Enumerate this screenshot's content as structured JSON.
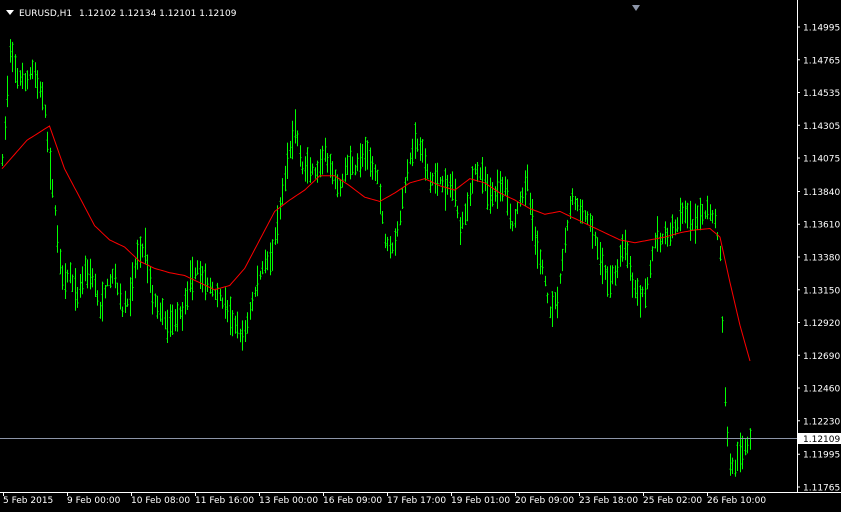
{
  "header": {
    "symbol": "EURUSD,H1",
    "ohlc": "1.12102 1.12134 1.12101 1.12109"
  },
  "colors": {
    "background": "#000000",
    "bars": "#00ff00",
    "moving_average": "#ff0000",
    "axis": "#ffffff",
    "price_line": "#8c95a8",
    "price_box": "#ffffff"
  },
  "icons": {
    "dropdown": "dropdown-triangle-icon",
    "shift_marker": "chart-shift-marker-icon"
  },
  "chart_data": {
    "type": "ohlc",
    "symbol": "EURUSD",
    "timeframe": "H1",
    "title": "EURUSD,H1",
    "current_price": 1.12109,
    "ylim": [
      1.1176,
      1.1507
    ],
    "y_ticks": [
      "1.14995",
      "1.14765",
      "1.14535",
      "1.14305",
      "1.14075",
      "1.13840",
      "1.13610",
      "1.13380",
      "1.13150",
      "1.12920",
      "1.12690",
      "1.12460",
      "1.12230",
      "1.11995",
      "1.11765"
    ],
    "x_ticks": [
      "5 Feb 2015",
      "9 Feb 00:00",
      "10 Feb 08:00",
      "11 Feb 16:00",
      "13 Feb 00:00",
      "16 Feb 09:00",
      "17 Feb 17:00",
      "19 Feb 01:00",
      "20 Feb 09:00",
      "23 Feb 18:00",
      "25 Feb 02:00",
      "26 Feb 10:00"
    ],
    "price_anchors": [
      [
        0,
        1.1405
      ],
      [
        3,
        1.148
      ],
      [
        6,
        1.1465
      ],
      [
        9,
        1.146
      ],
      [
        12,
        1.147
      ],
      [
        15,
        1.1455
      ],
      [
        17,
        1.144
      ],
      [
        19,
        1.14
      ],
      [
        21,
        1.137
      ],
      [
        24,
        1.132
      ],
      [
        27,
        1.1325
      ],
      [
        30,
        1.131
      ],
      [
        33,
        1.133
      ],
      [
        36,
        1.1325
      ],
      [
        39,
        1.13
      ],
      [
        42,
        1.132
      ],
      [
        45,
        1.1325
      ],
      [
        48,
        1.13
      ],
      [
        51,
        1.131
      ],
      [
        54,
        1.134
      ],
      [
        57,
        1.1345
      ],
      [
        60,
        1.131
      ],
      [
        63,
        1.13
      ],
      [
        66,
        1.129
      ],
      [
        69,
        1.1295
      ],
      [
        72,
        1.13
      ],
      [
        75,
        1.132
      ],
      [
        78,
        1.133
      ],
      [
        81,
        1.132
      ],
      [
        84,
        1.1315
      ],
      [
        87,
        1.131
      ],
      [
        90,
        1.13
      ],
      [
        93,
        1.129
      ],
      [
        96,
        1.128
      ],
      [
        99,
        1.13
      ],
      [
        102,
        1.132
      ],
      [
        105,
        1.1335
      ],
      [
        108,
        1.134
      ],
      [
        111,
        1.137
      ],
      [
        114,
        1.1405
      ],
      [
        117,
        1.143
      ],
      [
        120,
        1.14
      ],
      [
        123,
        1.14
      ],
      [
        126,
        1.1395
      ],
      [
        129,
        1.141
      ],
      [
        132,
        1.1395
      ],
      [
        135,
        1.1385
      ],
      [
        138,
        1.1405
      ],
      [
        141,
        1.14
      ],
      [
        144,
        1.141
      ],
      [
        147,
        1.1405
      ],
      [
        150,
        1.1395
      ],
      [
        153,
        1.135
      ],
      [
        156,
        1.1345
      ],
      [
        159,
        1.1365
      ],
      [
        162,
        1.14
      ],
      [
        165,
        1.142
      ],
      [
        168,
        1.141
      ],
      [
        171,
        1.139
      ],
      [
        174,
        1.1395
      ],
      [
        177,
        1.1385
      ],
      [
        180,
        1.139
      ],
      [
        183,
        1.136
      ],
      [
        186,
        1.1375
      ],
      [
        189,
        1.14
      ],
      [
        192,
        1.1395
      ],
      [
        195,
        1.138
      ],
      [
        198,
        1.1385
      ],
      [
        201,
        1.139
      ],
      [
        204,
        1.136
      ],
      [
        207,
        1.138
      ],
      [
        210,
        1.139
      ],
      [
        213,
        1.135
      ],
      [
        216,
        1.133
      ],
      [
        219,
        1.13
      ],
      [
        222,
        1.131
      ],
      [
        225,
        1.135
      ],
      [
        228,
        1.138
      ],
      [
        231,
        1.137
      ],
      [
        234,
        1.1365
      ],
      [
        237,
        1.135
      ],
      [
        240,
        1.133
      ],
      [
        243,
        1.132
      ],
      [
        246,
        1.133
      ],
      [
        249,
        1.135
      ],
      [
        252,
        1.132
      ],
      [
        255,
        1.131
      ],
      [
        258,
        1.132
      ],
      [
        261,
        1.135
      ],
      [
        264,
        1.135
      ],
      [
        267,
        1.1355
      ],
      [
        270,
        1.136
      ],
      [
        273,
        1.137
      ],
      [
        276,
        1.136
      ],
      [
        279,
        1.1365
      ],
      [
        282,
        1.137
      ],
      [
        285,
        1.1365
      ],
      [
        287,
        1.134
      ],
      [
        288,
        1.129
      ],
      [
        289,
        1.124
      ],
      [
        290,
        1.121
      ],
      [
        291,
        1.1195
      ],
      [
        293,
        1.119
      ],
      [
        295,
        1.12
      ],
      [
        297,
        1.1205
      ],
      [
        299,
        1.121
      ]
    ],
    "ma_anchors": [
      [
        0,
        1.14
      ],
      [
        10,
        1.142
      ],
      [
        19,
        1.143
      ],
      [
        25,
        1.14
      ],
      [
        31,
        1.138
      ],
      [
        37,
        1.136
      ],
      [
        43,
        1.135
      ],
      [
        49,
        1.1345
      ],
      [
        55,
        1.1335
      ],
      [
        61,
        1.133
      ],
      [
        67,
        1.1327
      ],
      [
        73,
        1.1325
      ],
      [
        79,
        1.132
      ],
      [
        85,
        1.1315
      ],
      [
        91,
        1.1318
      ],
      [
        97,
        1.133
      ],
      [
        103,
        1.135
      ],
      [
        109,
        1.137
      ],
      [
        115,
        1.1378
      ],
      [
        121,
        1.1385
      ],
      [
        127,
        1.1395
      ],
      [
        133,
        1.1395
      ],
      [
        139,
        1.1388
      ],
      [
        145,
        1.138
      ],
      [
        151,
        1.1377
      ],
      [
        157,
        1.1383
      ],
      [
        163,
        1.139
      ],
      [
        169,
        1.1393
      ],
      [
        175,
        1.1388
      ],
      [
        181,
        1.1385
      ],
      [
        187,
        1.1393
      ],
      [
        193,
        1.139
      ],
      [
        199,
        1.1383
      ],
      [
        205,
        1.1378
      ],
      [
        211,
        1.1372
      ],
      [
        217,
        1.1368
      ],
      [
        223,
        1.137
      ],
      [
        229,
        1.1365
      ],
      [
        235,
        1.136
      ],
      [
        241,
        1.1355
      ],
      [
        247,
        1.135
      ],
      [
        253,
        1.1348
      ],
      [
        259,
        1.135
      ],
      [
        265,
        1.1352
      ],
      [
        271,
        1.1355
      ],
      [
        277,
        1.1357
      ],
      [
        283,
        1.1358
      ],
      [
        287,
        1.1352
      ],
      [
        291,
        1.132
      ],
      [
        295,
        1.129
      ],
      [
        299,
        1.1265
      ]
    ]
  }
}
